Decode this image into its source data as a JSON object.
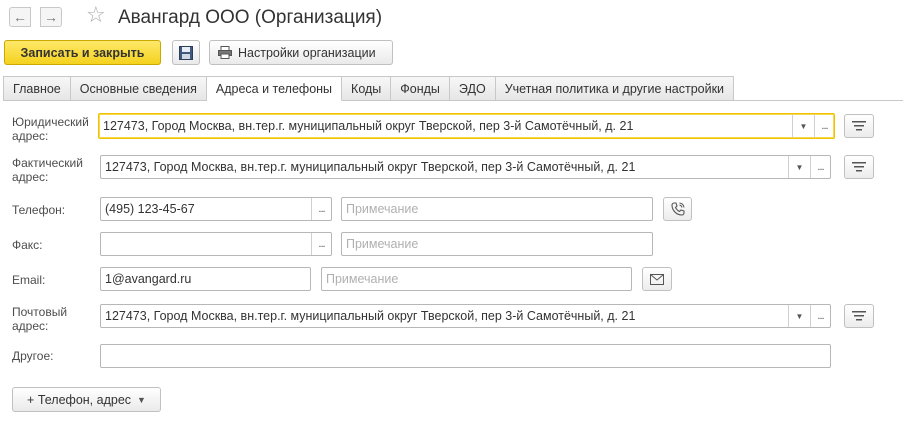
{
  "header": {
    "back_icon": "arrow-left-icon",
    "forward_icon": "arrow-right-icon",
    "favorite_icon": "star-icon",
    "title": "Авангард ООО (Организация)"
  },
  "toolbar": {
    "save_close_label": "Записать и закрыть",
    "save_icon": "floppy-disk-icon",
    "settings_label": "Настройки организации",
    "settings_icon": "printer-icon"
  },
  "tabs": [
    {
      "label": "Главное"
    },
    {
      "label": "Основные сведения"
    },
    {
      "label": "Адреса и телефоны",
      "active": true
    },
    {
      "label": "Коды"
    },
    {
      "label": "Фонды"
    },
    {
      "label": "ЭДО"
    },
    {
      "label": "Учетная политика и другие настройки"
    }
  ],
  "form": {
    "legal_address": {
      "label_line1": "Юридический",
      "label_line2": "адрес:",
      "value": "127473, Город Москва, вн.тер.г. муниципальный округ Тверской, пер 3-й Самотёчный, д. 21"
    },
    "actual_address": {
      "label_line1": "Фактический",
      "label_line2": "адрес:",
      "value": "127473, Город Москва, вн.тер.г. муниципальный округ Тверской, пер 3-й Самотёчный, д. 21"
    },
    "phone": {
      "label": "Телефон:",
      "value": "(495) 123-45-67",
      "note_placeholder": "Примечание"
    },
    "fax": {
      "label": "Факс:",
      "value": "",
      "note_placeholder": "Примечание"
    },
    "email": {
      "label": "Email:",
      "value": "1@avangard.ru",
      "note_placeholder": "Примечание"
    },
    "postal_address": {
      "label_line1": "Почтовый",
      "label_line2": "адрес:",
      "value": "127473, Город Москва, вн.тер.г. муниципальный округ Тверской, пер 3-й Самотёчный, д. 21"
    },
    "other": {
      "label": "Другое:",
      "value": ""
    },
    "add_button_label": "+ Телефон, адрес"
  },
  "colors": {
    "primary_button": "#f4d21e",
    "focus_border": "#f2c200"
  }
}
